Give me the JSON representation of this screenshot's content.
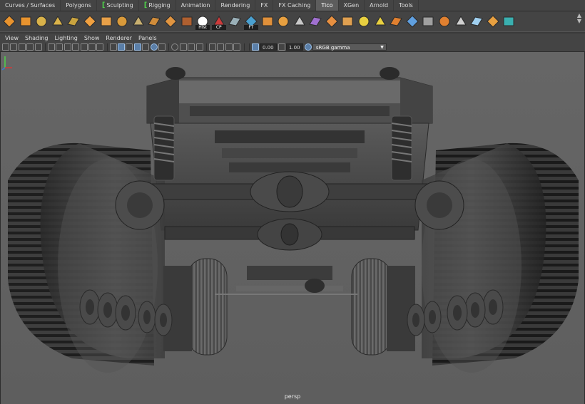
{
  "shelf": {
    "tabs": [
      {
        "label": "Curves / Surfaces",
        "active": false,
        "bracket": false
      },
      {
        "label": "Polygons",
        "active": false,
        "bracket": false
      },
      {
        "label": "Sculpting",
        "active": false,
        "bracket": true
      },
      {
        "label": "Rigging",
        "active": false,
        "bracket": true
      },
      {
        "label": "Animation",
        "active": false,
        "bracket": false
      },
      {
        "label": "Rendering",
        "active": false,
        "bracket": false
      },
      {
        "label": "FX",
        "active": false,
        "bracket": false
      },
      {
        "label": "FX Caching",
        "active": false,
        "bracket": false
      },
      {
        "label": "Tico",
        "active": true,
        "bracket": false
      },
      {
        "label": "XGen",
        "active": false,
        "bracket": false
      },
      {
        "label": "Arnold",
        "active": false,
        "bracket": false
      },
      {
        "label": "Tools",
        "active": false,
        "bracket": false
      }
    ],
    "icons": [
      {
        "name": "poly-diamond-icon",
        "color": "#e8932e",
        "label": ""
      },
      {
        "name": "poly-diamond-alt-icon",
        "color": "#e8932e",
        "label": ""
      },
      {
        "name": "poly-plane-grid-icon",
        "color": "#d9b24a",
        "label": ""
      },
      {
        "name": "poly-plane-subdiv-icon",
        "color": "#d9b24a",
        "label": ""
      },
      {
        "name": "poly-plane-curve-icon",
        "color": "#c9a33f",
        "label": ""
      },
      {
        "name": "poly-cube-icon",
        "color": "#f0a040",
        "label": ""
      },
      {
        "name": "poly-sphere-icon",
        "color": "#e8a048",
        "label": ""
      },
      {
        "name": "poly-box-stack-icon",
        "color": "#d99a3a",
        "label": ""
      },
      {
        "name": "poly-cards-icon",
        "color": "#c8b070",
        "label": ""
      },
      {
        "name": "poly-grid-pattern-icon",
        "color": "#d08c3a",
        "label": ""
      },
      {
        "name": "poly-cylinder-icon",
        "color": "#e09440",
        "label": ""
      },
      {
        "name": "poly-block-icon",
        "color": "#b06030",
        "label": ""
      },
      {
        "name": "history-icon",
        "color": "#ffffff",
        "label": "Hist"
      },
      {
        "name": "center-pivot-icon",
        "color": "#cc3a3a",
        "label": "CP"
      },
      {
        "name": "poly-flat-icon",
        "color": "#9ab0b8",
        "label": ""
      },
      {
        "name": "freeze-transform-icon",
        "color": "#4aa0d0",
        "label": "FT"
      },
      {
        "name": "poly-layers-icon",
        "color": "#e0903a",
        "label": ""
      },
      {
        "name": "poly-bevel-icon",
        "color": "#e8a040",
        "label": ""
      },
      {
        "name": "poly-target-icon",
        "color": "#c8c8c8",
        "label": ""
      },
      {
        "name": "wire-cage-icon",
        "color": "#a070d0",
        "label": ""
      },
      {
        "name": "poly-cut-icon",
        "color": "#e89040",
        "label": ""
      },
      {
        "name": "poly-bend-icon",
        "color": "#e0a050",
        "label": ""
      },
      {
        "name": "move-arrows-icon",
        "color": "#e8d040",
        "label": ""
      },
      {
        "name": "select-cross-icon",
        "color": "#e8d040",
        "label": ""
      },
      {
        "name": "poly-dotgrid-icon",
        "color": "#e08030",
        "label": ""
      },
      {
        "name": "joint-tool-icon",
        "color": "#60a0e0",
        "label": ""
      },
      {
        "name": "ik-handle-icon",
        "color": "#a0a0a0",
        "label": ""
      },
      {
        "name": "skin-bind-icon",
        "color": "#e08030",
        "label": ""
      },
      {
        "name": "paint-tool-icon",
        "color": "#d0d0d0",
        "label": ""
      },
      {
        "name": "brush-tool-icon",
        "color": "#a0d0f0",
        "label": ""
      },
      {
        "name": "render-preview-icon",
        "color": "#e8a040",
        "label": ""
      },
      {
        "name": "arnold-logo-icon",
        "color": "#3ab0b0",
        "label": ""
      }
    ]
  },
  "panel_menu": [
    "View",
    "Shading",
    "Lighting",
    "Show",
    "Renderer",
    "Panels"
  ],
  "panel_toolbar": {
    "exposure_value": "0.00",
    "gamma_value": "1.00",
    "color_space": "sRGB gamma"
  },
  "viewport": {
    "camera": "persp"
  }
}
